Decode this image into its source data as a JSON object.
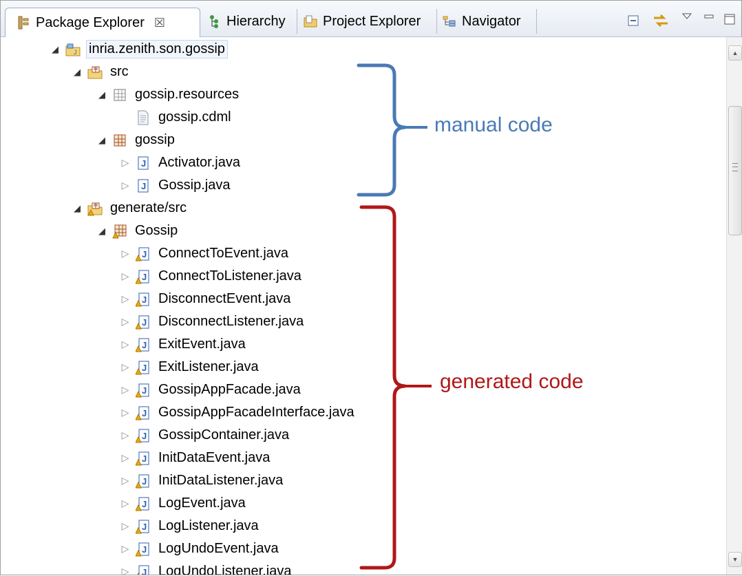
{
  "tabs": [
    {
      "label": "Package Explorer",
      "close": "☒",
      "icon": "package-explorer-icon",
      "active": true
    },
    {
      "label": "Hierarchy",
      "icon": "hierarchy-icon",
      "active": false
    },
    {
      "label": "Project Explorer",
      "icon": "project-explorer-icon",
      "active": false
    },
    {
      "label": "Navigator",
      "icon": "navigator-icon",
      "active": false
    }
  ],
  "toolbar": {
    "buttons": [
      "collapse-all-icon",
      "link-with-editor-icon",
      "view-menu-icon",
      "minimize-icon",
      "maximize-icon"
    ]
  },
  "tree": [
    {
      "label": "inria.zenith.son.gossip",
      "kind": "project",
      "state": "open",
      "level": 0,
      "selected": true
    },
    {
      "label": "src",
      "kind": "source-folder",
      "state": "open",
      "level": 1
    },
    {
      "label": "gossip.resources",
      "kind": "empty-package",
      "state": "open",
      "level": 2
    },
    {
      "label": "gossip.cdml",
      "kind": "file",
      "state": "leaf",
      "level": 3
    },
    {
      "label": "gossip",
      "kind": "package",
      "state": "open",
      "level": 2
    },
    {
      "label": "Activator.java",
      "kind": "java",
      "state": "closed",
      "level": 3
    },
    {
      "label": "Gossip.java",
      "kind": "java",
      "state": "closed",
      "level": 3
    },
    {
      "label": "generate/src",
      "kind": "source-folder-warn",
      "state": "open",
      "level": 1
    },
    {
      "label": "Gossip",
      "kind": "package-warn",
      "state": "open",
      "level": 2
    },
    {
      "label": "ConnectToEvent.java",
      "kind": "java-warn",
      "state": "closed",
      "level": 3
    },
    {
      "label": "ConnectToListener.java",
      "kind": "java-warn",
      "state": "closed",
      "level": 3
    },
    {
      "label": "DisconnectEvent.java",
      "kind": "java-warn",
      "state": "closed",
      "level": 3
    },
    {
      "label": "DisconnectListener.java",
      "kind": "java-warn",
      "state": "closed",
      "level": 3
    },
    {
      "label": "ExitEvent.java",
      "kind": "java-warn",
      "state": "closed",
      "level": 3
    },
    {
      "label": "ExitListener.java",
      "kind": "java-warn",
      "state": "closed",
      "level": 3
    },
    {
      "label": "GossipAppFacade.java",
      "kind": "java-warn",
      "state": "closed",
      "level": 3
    },
    {
      "label": "GossipAppFacadeInterface.java",
      "kind": "java-warn",
      "state": "closed",
      "level": 3
    },
    {
      "label": "GossipContainer.java",
      "kind": "java-warn",
      "state": "closed",
      "level": 3
    },
    {
      "label": "InitDataEvent.java",
      "kind": "java-warn",
      "state": "closed",
      "level": 3
    },
    {
      "label": "InitDataListener.java",
      "kind": "java-warn",
      "state": "closed",
      "level": 3
    },
    {
      "label": "LogEvent.java",
      "kind": "java-warn",
      "state": "closed",
      "level": 3
    },
    {
      "label": "LogListener.java",
      "kind": "java-warn",
      "state": "closed",
      "level": 3
    },
    {
      "label": "LogUndoEvent.java",
      "kind": "java-warn",
      "state": "closed",
      "level": 3
    },
    {
      "label": "LogUndoListener.java",
      "kind": "java-warn",
      "state": "closed",
      "level": 3
    }
  ],
  "annotations": {
    "manual": {
      "label": "manual code",
      "color": "#4a7ab5"
    },
    "generated": {
      "label": "generated code",
      "color": "#b01818"
    }
  },
  "colors": {
    "java_blue": "#2f5fb3",
    "package_brown": "#a0522d",
    "folder_yellow": "#e8b84a",
    "warning": "#f0a800"
  }
}
